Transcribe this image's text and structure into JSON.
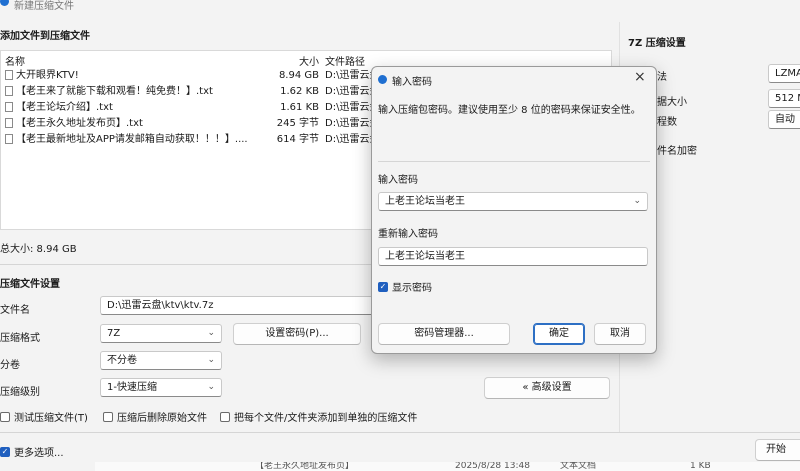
{
  "window": {
    "title": "新建压缩文件"
  },
  "files_section": {
    "heading": "添加文件到压缩文件",
    "columns": {
      "name": "名称",
      "size": "大小",
      "path": "文件路径"
    },
    "rows": [
      {
        "name": "大开眼界KTV!",
        "size": "8.94 GB",
        "path": "D:\\迅雷云盘"
      },
      {
        "name": "【老王来了就能下载和观看！纯免费！】.txt",
        "size": "1.62 KB",
        "path": "D:\\迅雷云盘"
      },
      {
        "name": "【老王论坛介绍】.txt",
        "size": "1.61 KB",
        "path": "D:\\迅雷云盘"
      },
      {
        "name": "【老王永久地址发布页】.txt",
        "size": "245 字节",
        "path": "D:\\迅雷云盘"
      },
      {
        "name": "【老王最新地址及APP请发邮箱自动获取！！！】....",
        "size": "614 字节",
        "path": "D:\\迅雷云盘"
      }
    ],
    "total": "总大小: 8.94 GB"
  },
  "compress_settings": {
    "heading": "压缩文件设置",
    "filename_label": "文件名",
    "filename_value": "D:\\迅雷云盘\\ktv\\ktv.7z",
    "format_label": "压缩格式",
    "format_value": "7Z",
    "set_password_button": "设置密码(P)...",
    "split_label": "分卷",
    "split_value": "不分卷",
    "level_label": "压缩级别",
    "level_value": "1-快速压缩",
    "advanced_button": "« 高级设置",
    "test_checkbox": "测试压缩文件(T)",
    "delete_checkbox": "压缩后删除原始文件",
    "separate_checkbox": "把每个文件/文件夹添加到单独的压缩文件",
    "more_options": "更多选项...",
    "start_button": "开始"
  },
  "sevenz_settings": {
    "heading": "7Z 压缩设置",
    "method_label": "法",
    "method_value": "LZMA",
    "dict_label": "据大小",
    "dict_value": "512 M",
    "threads_label": "程数",
    "threads_value": "自动",
    "encrypt_label": "件名加密"
  },
  "dialog": {
    "title": "输入密码",
    "description": "输入压缩包密码。建议使用至少 8 位的密码来保证安全性。",
    "password_label": "输入密码",
    "password_value": "上老王论坛当老王",
    "reenter_label": "重新输入密码",
    "reenter_value": "上老王论坛当老王",
    "show_password": "显示密码",
    "manager_button": "密码管理器...",
    "ok_button": "确定",
    "cancel_button": "取消"
  },
  "background_row": {
    "name": "【老王永久地址发布页】",
    "date": "2025/8/28 13:48",
    "type": "文本文档",
    "size": "1 KB"
  },
  "colors": {
    "accent": "#1f5fbf",
    "window_bg": "#f3f3f3"
  }
}
